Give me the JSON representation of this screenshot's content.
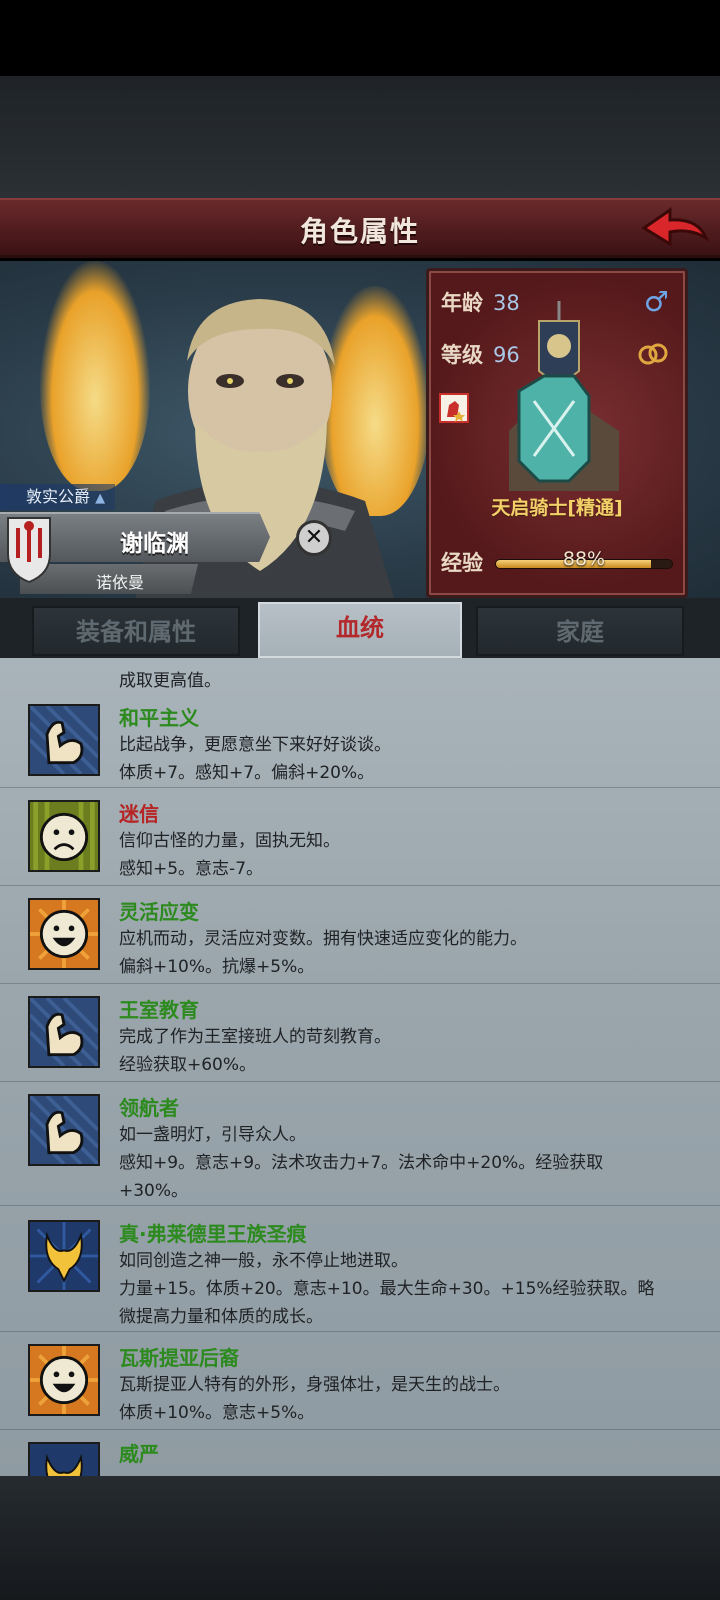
{
  "header": {
    "title": "角色属性"
  },
  "character": {
    "nobility": "敦实公爵",
    "name": "谢临渊",
    "house": "诺依曼",
    "age_label": "年龄",
    "age": "38",
    "level_label": "等级",
    "level": "96",
    "gender_symbol": "♂",
    "class_name": "天启骑士[精通]",
    "exp_label": "经验",
    "exp_percent": 88,
    "exp_text": "88%"
  },
  "tabs": [
    {
      "label": "装备和属性"
    },
    {
      "label": "血统"
    },
    {
      "label": "家庭"
    }
  ],
  "traits": {
    "partial_line": "成取更高值。",
    "items": [
      {
        "name": "和平主义",
        "icon": "muscle-icon",
        "lines": [
          "比起战争，更愿意坐下来好好谈谈。",
          "体质+7。感知+7。偏斜+20%。"
        ]
      },
      {
        "name": "迷信",
        "icon": "sad-face-icon",
        "lines": [
          "信仰古怪的力量，固执无知。",
          "感知+5。意志-7。"
        ]
      },
      {
        "name": "灵活应变",
        "icon": "happy-face-icon",
        "lines": [
          "应机而动，灵活应对变数。拥有快速适应变化的能力。",
          "偏斜+10%。抗爆+5%。"
        ]
      },
      {
        "name": "王室教育",
        "icon": "muscle-icon",
        "lines": [
          "完成了作为王室接班人的苛刻教育。",
          "经验获取+60%。"
        ]
      },
      {
        "name": "领航者",
        "icon": "muscle-icon",
        "lines": [
          "如一盏明灯，引导众人。",
          "感知+9。意志+9。法术攻击力+7。法术命中+20%。经验获取",
          "+30%。"
        ]
      },
      {
        "name": "真·弗莱德里王族圣痕",
        "icon": "royal-stigmata-icon",
        "lines": [
          "如同创造之神一般，永不停止地进取。",
          "力量+15。体质+20。意志+10。最大生命+30。+15%经验获取。略",
          "微提高力量和体质的成长。"
        ]
      },
      {
        "name": "瓦斯提亚后裔",
        "icon": "happy-face-icon",
        "lines": [
          "瓦斯提亚人特有的外形，身强体壮，是天生的战士。",
          "体质+10%。意志+5%。"
        ]
      },
      {
        "name": "威严",
        "icon": "royal-stigmata-icon",
        "lines": []
      }
    ]
  }
}
